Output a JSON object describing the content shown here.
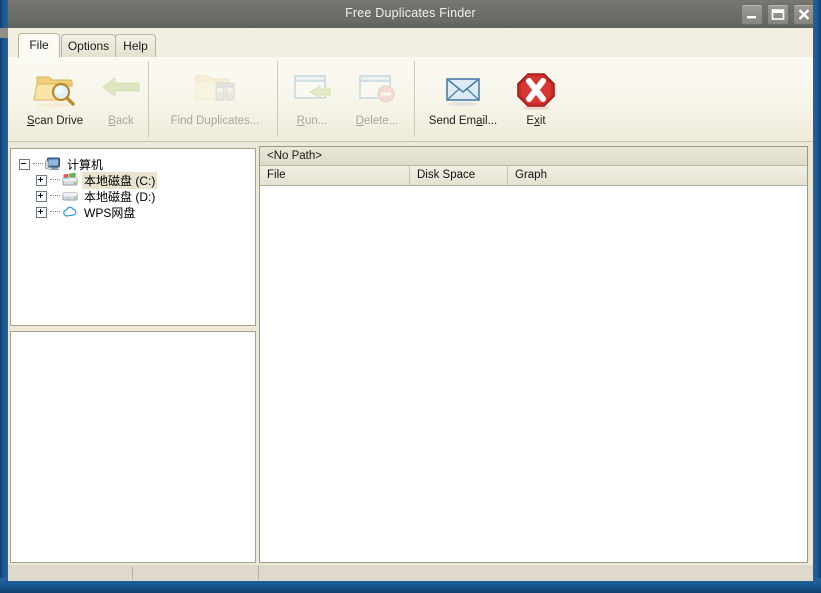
{
  "window": {
    "title": "Free Duplicates Finder",
    "controls": [
      {
        "name": "minimize-button",
        "glyph": "_"
      },
      {
        "name": "maximize-button",
        "glyph": "□"
      },
      {
        "name": "close-button",
        "glyph": "X"
      }
    ]
  },
  "tabs": [
    {
      "label": "File",
      "active": true
    },
    {
      "label": "Options",
      "active": false
    },
    {
      "label": "Help",
      "active": false
    }
  ],
  "toolbar": {
    "buttons": [
      {
        "id": "scan-drive",
        "label": "Scan Drive",
        "accel": "S",
        "icon": "folder-search-icon",
        "enabled": true
      },
      {
        "id": "back",
        "label": "Back",
        "accel": "B",
        "icon": "green-left-arrow-icon",
        "enabled": false
      },
      {
        "id": "find-duplicates",
        "label": "Find Duplicates...",
        "accel": "",
        "icon": "folder-binoculars-icon",
        "enabled": false
      },
      {
        "id": "run",
        "label": "Run...",
        "accel": "R",
        "icon": "window-run-icon",
        "enabled": false
      },
      {
        "id": "delete",
        "label": "Delete...",
        "accel": "D",
        "icon": "window-delete-icon",
        "enabled": false
      },
      {
        "id": "send-email",
        "label": "Send Email...",
        "accel": "a",
        "icon": "envelope-icon",
        "enabled": true
      },
      {
        "id": "exit",
        "label": "Exit",
        "accel": "x",
        "icon": "red-octagon-x-icon",
        "enabled": true
      }
    ]
  },
  "tree": {
    "nodes": [
      {
        "label": "计算机",
        "icon": "computer-icon",
        "expander": "minus",
        "depth": 0,
        "selected": false
      },
      {
        "label": "本地磁盘 (C:)",
        "icon": "system-drive-icon",
        "expander": "plus",
        "depth": 1,
        "selected": true
      },
      {
        "label": "本地磁盘 (D:)",
        "icon": "hard-drive-icon",
        "expander": "plus",
        "depth": 1,
        "selected": false
      },
      {
        "label": "WPS网盘",
        "icon": "cloud-drive-icon",
        "expander": "plus",
        "depth": 1,
        "selected": false
      }
    ]
  },
  "list": {
    "path": "<No Path>",
    "columns": [
      {
        "label": "File"
      },
      {
        "label": "Disk Space"
      },
      {
        "label": "Graph"
      }
    ],
    "rows": []
  },
  "status": {
    "cells": [
      "",
      "",
      ""
    ]
  },
  "colors": {
    "titlebar": "#6b6d68",
    "ribbon": "#f7f5e9",
    "selection": "#e8e4cf",
    "accent_red": "#cc2222",
    "accent_blue": "#5b8fb5",
    "folder_yellow": "#f2d98a"
  }
}
